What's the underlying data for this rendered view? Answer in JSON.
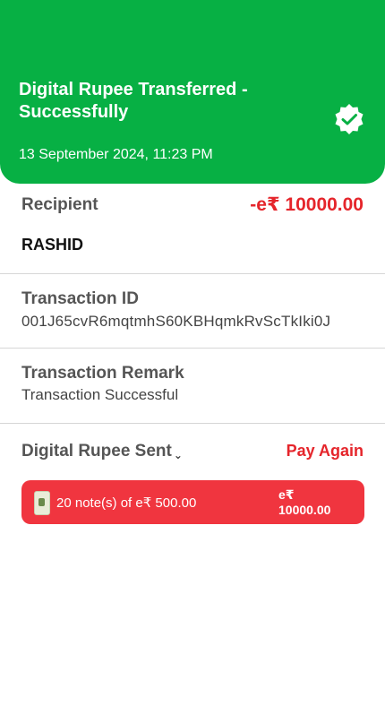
{
  "header": {
    "title": "Digital Rupee Transferred - Successfully",
    "datetime": "13 September 2024, 11:23 PM",
    "status_icon": "verified-check-icon",
    "bg_color": "#07b044"
  },
  "recipient": {
    "label": "Recipient",
    "amount": "-e₹ 10000.00",
    "name": "RASHID"
  },
  "transaction": {
    "id_label": "Transaction ID",
    "id_value": "001J65cvR6mqtmhS60KBHqmkRvScTkIki0J",
    "remark_label": "Transaction Remark",
    "remark_value": "Transaction Successful"
  },
  "sent": {
    "label": "Digital Rupee Sent",
    "pay_again": "Pay Again",
    "notes_text": "20 note(s) of e₹ 500.00",
    "total_currency": "e₹",
    "total_amount": "10000.00",
    "accent_color": "#e5252b"
  }
}
